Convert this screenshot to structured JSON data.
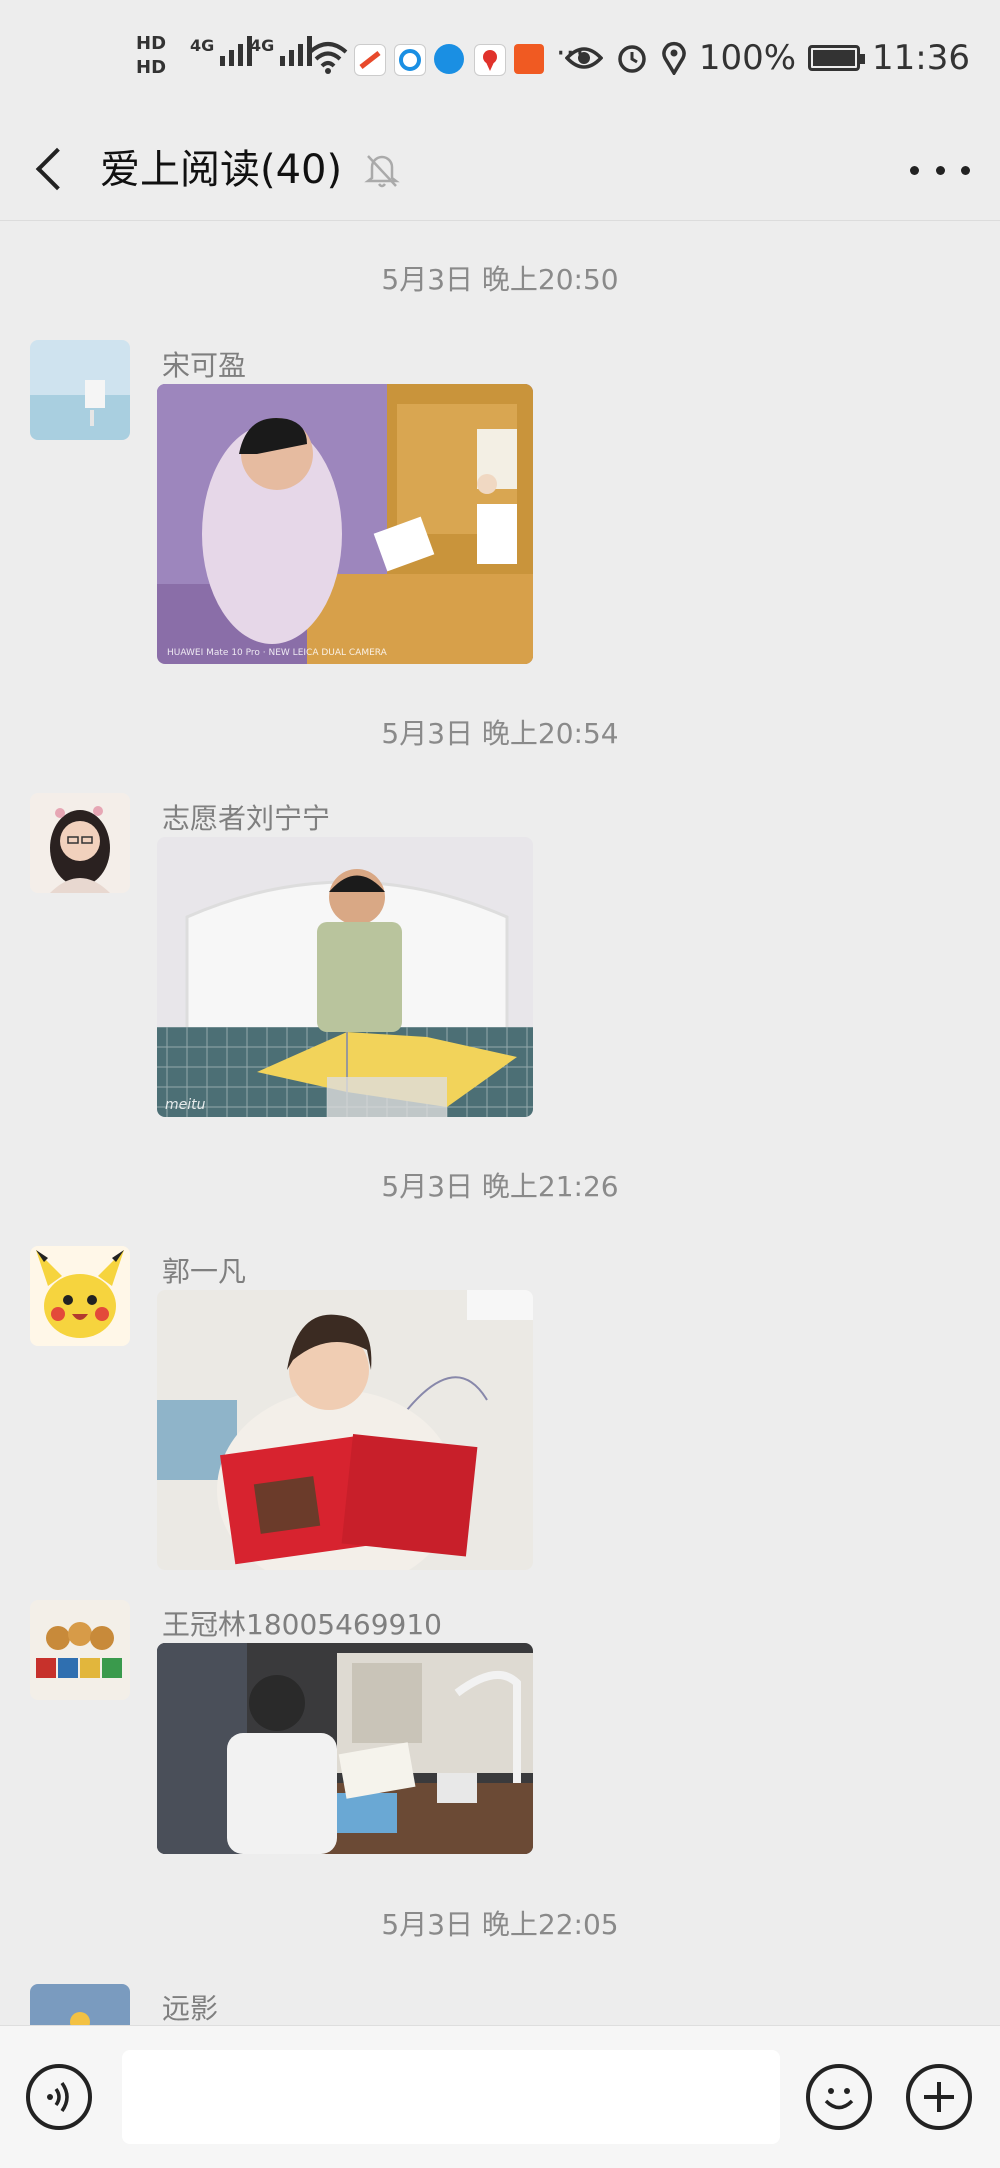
{
  "status_bar": {
    "hd1": "HD",
    "hd2": "HD",
    "sim1_net": "4G",
    "sim2_net": "4G",
    "more": "···",
    "battery": "100%",
    "time": "11:36"
  },
  "header": {
    "title": "爱上阅读(40)"
  },
  "messages": [
    {
      "time": "5月3日 晚上20:50",
      "sender": "宋可盈"
    },
    {
      "time": "5月3日 晚上20:54",
      "sender": "志愿者刘宁宁"
    },
    {
      "time": "5月3日 晚上21:26",
      "sender": "郭一凡"
    },
    {
      "sender": "王冠林18005469910"
    },
    {
      "time": "5月3日 晚上22:05",
      "sender": "远影"
    }
  ],
  "photo_watermarks": {
    "photo1": "HUAWEI Mate 10 Pro · NEW LEICA DUAL CAMERA",
    "photo2": "meitu"
  },
  "input": {
    "value": ""
  },
  "colors": {
    "background": "#ededed",
    "timestamp": "#8a8a8a",
    "sender": "#7f7f7f"
  }
}
